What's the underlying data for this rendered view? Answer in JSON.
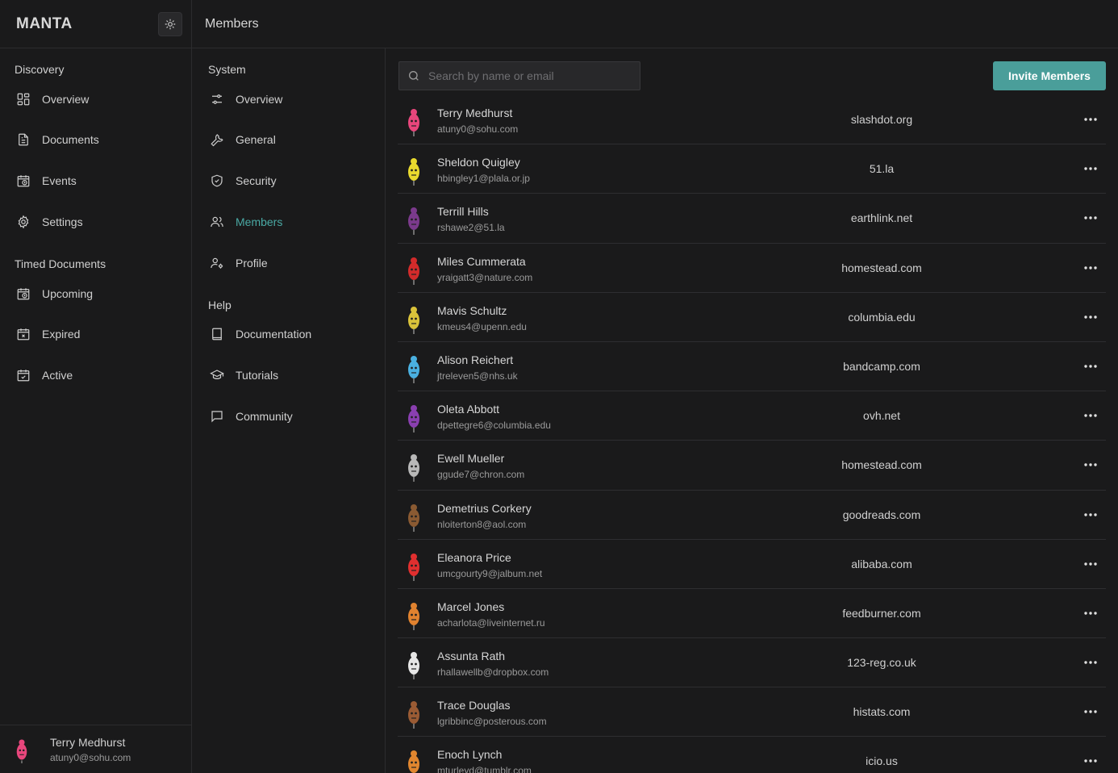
{
  "app": {
    "brand": "MANTA",
    "page_title": "Members"
  },
  "colors": {
    "accent": "#4a9e9a",
    "active_text": "#4aa9a4",
    "background": "#1a1a1b"
  },
  "sidebar": {
    "sections": [
      {
        "label": "Discovery",
        "items": [
          {
            "label": "Overview",
            "icon": "grid-icon"
          },
          {
            "label": "Documents",
            "icon": "document-icon"
          },
          {
            "label": "Events",
            "icon": "calendar-clock-icon"
          },
          {
            "label": "Settings",
            "icon": "gear-icon"
          }
        ]
      },
      {
        "label": "Timed Documents",
        "items": [
          {
            "label": "Upcoming",
            "icon": "calendar-clock-icon"
          },
          {
            "label": "Expired",
            "icon": "calendar-x-icon"
          },
          {
            "label": "Active",
            "icon": "calendar-check-icon"
          }
        ]
      }
    ],
    "user": {
      "name": "Terry Medhurst",
      "email": "atuny0@sohu.com"
    }
  },
  "subnav": {
    "sections": [
      {
        "label": "System",
        "items": [
          {
            "label": "Overview",
            "icon": "sliders-icon"
          },
          {
            "label": "General",
            "icon": "wrench-icon"
          },
          {
            "label": "Security",
            "icon": "shield-check-icon"
          },
          {
            "label": "Members",
            "icon": "users-icon",
            "active": true
          },
          {
            "label": "Profile",
            "icon": "user-cog-icon"
          }
        ]
      },
      {
        "label": "Help",
        "items": [
          {
            "label": "Documentation",
            "icon": "book-icon"
          },
          {
            "label": "Tutorials",
            "icon": "graduation-cap-icon"
          },
          {
            "label": "Community",
            "icon": "message-square-icon"
          }
        ]
      }
    ]
  },
  "search": {
    "placeholder": "Search by name or email",
    "value": ""
  },
  "invite_label": "Invite Members",
  "members": [
    {
      "name": "Terry Medhurst",
      "email": "atuny0@sohu.com",
      "domain": "slashdot.org",
      "avatar_color": "#e8467c"
    },
    {
      "name": "Sheldon Quigley",
      "email": "hbingley1@plala.or.jp",
      "domain": "51.la",
      "avatar_color": "#e8d92e"
    },
    {
      "name": "Terrill Hills",
      "email": "rshawe2@51.la",
      "domain": "earthlink.net",
      "avatar_color": "#7b3a8c"
    },
    {
      "name": "Miles Cummerata",
      "email": "yraigatt3@nature.com",
      "domain": "homestead.com",
      "avatar_color": "#d22b2b"
    },
    {
      "name": "Mavis Schultz",
      "email": "kmeus4@upenn.edu",
      "domain": "columbia.edu",
      "avatar_color": "#d9c23a"
    },
    {
      "name": "Alison Reichert",
      "email": "jtreleven5@nhs.uk",
      "domain": "bandcamp.com",
      "avatar_color": "#4ab0e0"
    },
    {
      "name": "Oleta Abbott",
      "email": "dpettegre6@columbia.edu",
      "domain": "ovh.net",
      "avatar_color": "#8a3fb0"
    },
    {
      "name": "Ewell Mueller",
      "email": "ggude7@chron.com",
      "domain": "homestead.com",
      "avatar_color": "#b8b8b8"
    },
    {
      "name": "Demetrius Corkery",
      "email": "nloiterton8@aol.com",
      "domain": "goodreads.com",
      "avatar_color": "#8a5a32"
    },
    {
      "name": "Eleanora Price",
      "email": "umcgourty9@jalbum.net",
      "domain": "alibaba.com",
      "avatar_color": "#e02f2f"
    },
    {
      "name": "Marcel Jones",
      "email": "acharlota@liveinternet.ru",
      "domain": "feedburner.com",
      "avatar_color": "#e0822f"
    },
    {
      "name": "Assunta Rath",
      "email": "rhallawellb@dropbox.com",
      "domain": "123-reg.co.uk",
      "avatar_color": "#e6e6e6"
    },
    {
      "name": "Trace Douglas",
      "email": "lgribbinc@posterous.com",
      "domain": "histats.com",
      "avatar_color": "#9a5b34"
    },
    {
      "name": "Enoch Lynch",
      "email": "mturleyd@tumblr.com",
      "domain": "icio.us",
      "avatar_color": "#e0862f"
    }
  ]
}
